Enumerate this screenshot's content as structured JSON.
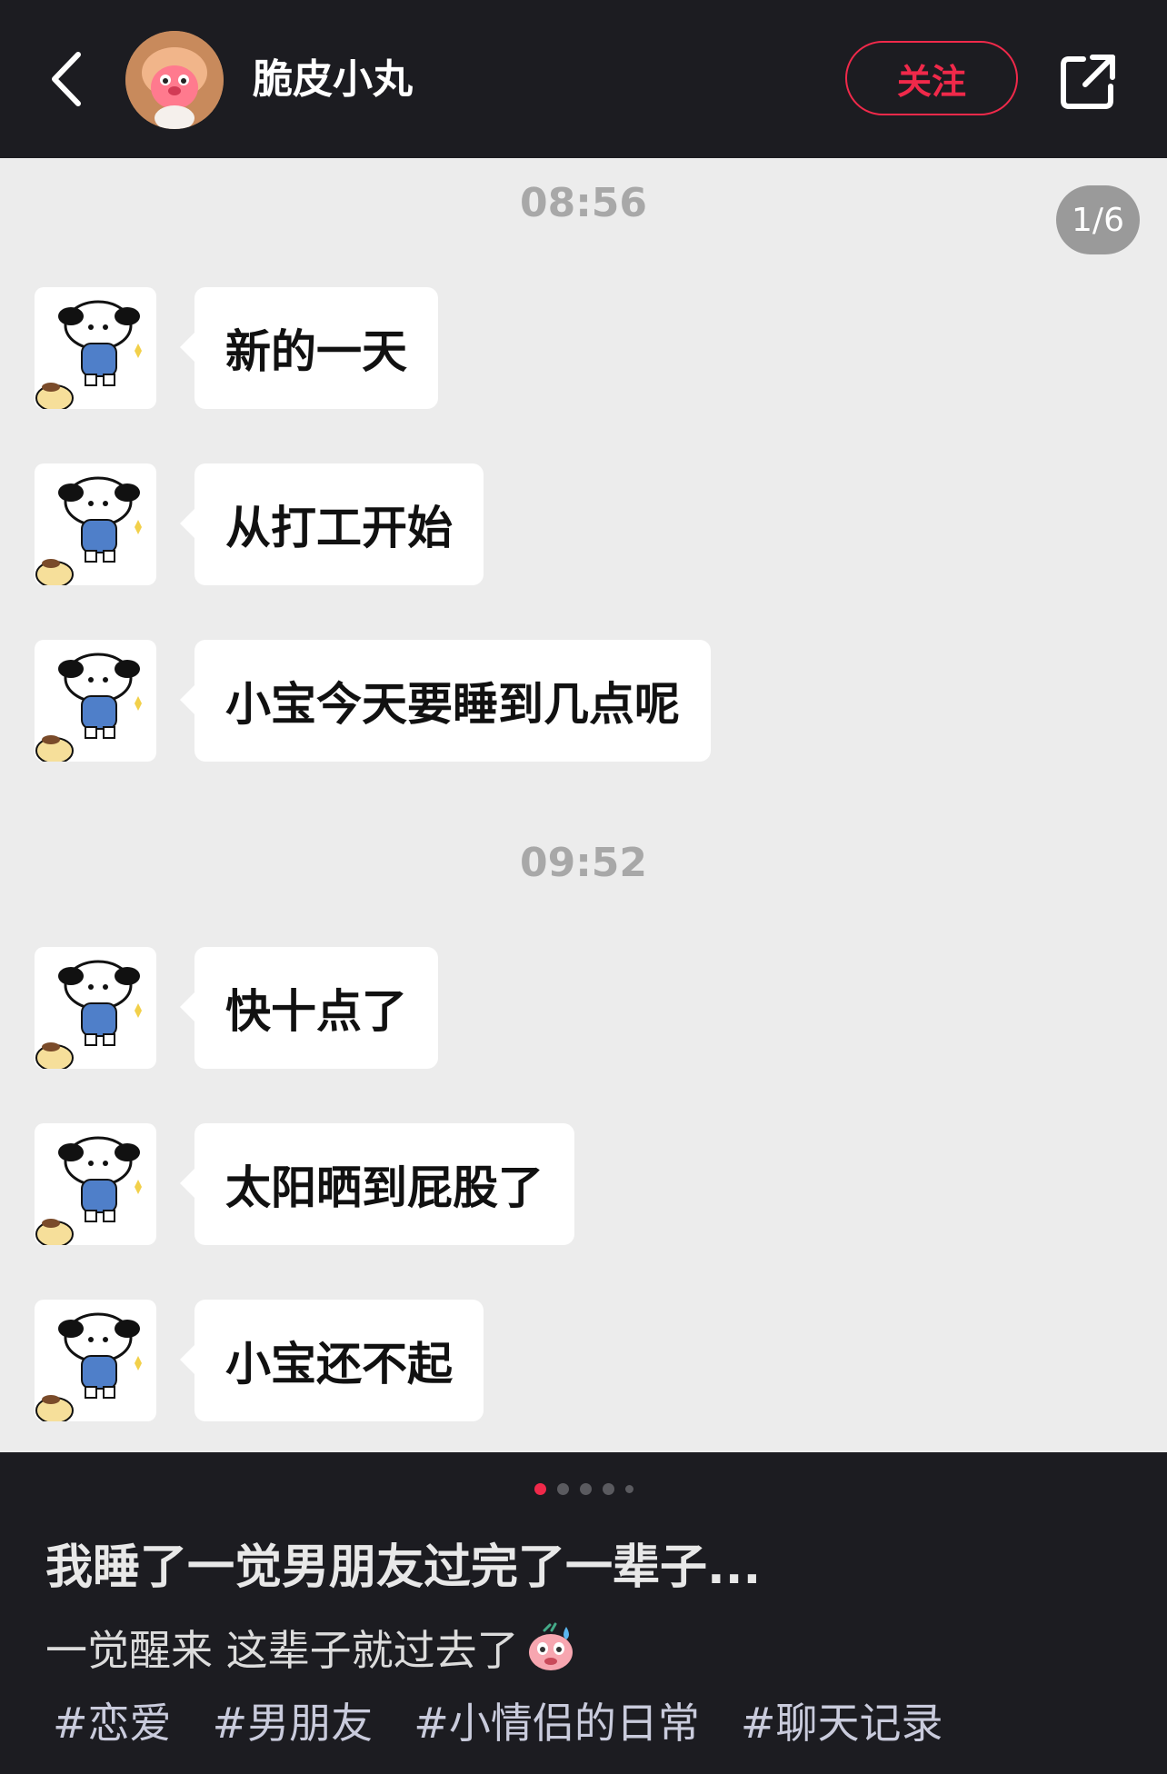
{
  "header": {
    "username": "脆皮小丸",
    "follow_label": "关注"
  },
  "chat": {
    "page_counter": "1/6",
    "timestamps": [
      "08:56",
      "09:52"
    ],
    "messages": [
      {
        "text": "新的一天"
      },
      {
        "text": "从打工开始"
      },
      {
        "text": "小宝今天要睡到几点呢"
      },
      {
        "text": "快十点了"
      },
      {
        "text": "太阳晒到屁股了"
      },
      {
        "text": "小宝还不起"
      }
    ]
  },
  "post": {
    "carousel_total": 5,
    "carousel_active": 1,
    "title": "我睡了一觉男朋友过完了一辈子...",
    "description": "一觉醒来 这辈子就过去了",
    "emoji_icon": "sweating-face-icon",
    "tags": [
      "#恋爱",
      "#男朋友",
      "#小情侣的日常",
      "#聊天记录"
    ]
  },
  "colors": {
    "accent": "#f0294a",
    "bar_bg": "#1c1c21",
    "chat_bg": "#ececec"
  }
}
